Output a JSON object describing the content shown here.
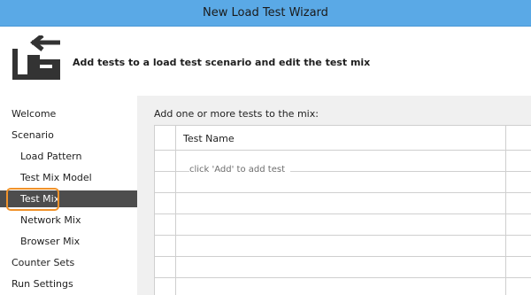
{
  "window": {
    "title": "New Load Test Wizard"
  },
  "header": {
    "heading": "Add tests to a load test scenario and edit the test mix",
    "icon": "load-test-wizard-icon"
  },
  "sidebar": {
    "items": [
      {
        "label": "Welcome",
        "level": 0,
        "selected": false
      },
      {
        "label": "Scenario",
        "level": 0,
        "selected": false
      },
      {
        "label": "Load Pattern",
        "level": 1,
        "selected": false
      },
      {
        "label": "Test Mix Model",
        "level": 1,
        "selected": false
      },
      {
        "label": "Test Mix",
        "level": 1,
        "selected": true
      },
      {
        "label": "Network Mix",
        "level": 1,
        "selected": false
      },
      {
        "label": "Browser Mix",
        "level": 1,
        "selected": false
      },
      {
        "label": "Counter Sets",
        "level": 0,
        "selected": false
      },
      {
        "label": "Run Settings",
        "level": 0,
        "selected": false
      }
    ]
  },
  "main": {
    "prompt": "Add one or more tests to the mix:",
    "grid": {
      "columns": [
        "Test Name"
      ],
      "placeholder": "click 'Add' to add test"
    }
  },
  "colors": {
    "titlebar": "#5aa9e6",
    "selected": "#4d4d4d",
    "highlight": "#f0922a"
  }
}
